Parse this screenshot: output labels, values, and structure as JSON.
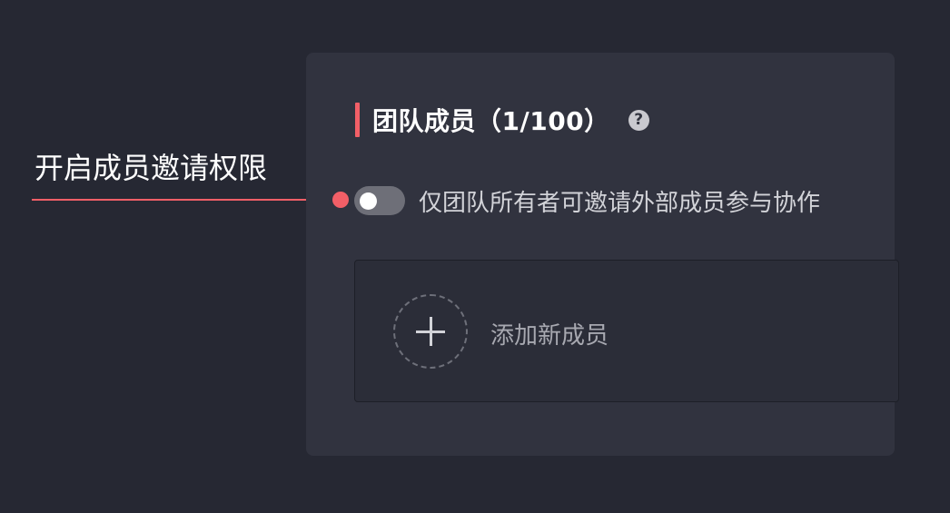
{
  "annotation": {
    "label": "开启成员邀请权限"
  },
  "panel": {
    "title": "团队成员（1/100）",
    "help_icon_glyph": "?",
    "toggle": {
      "state": "off",
      "label": "仅团队所有者可邀请外部成员参与协作"
    },
    "add_member": {
      "label": "添加新成员"
    }
  },
  "colors": {
    "accent": "#f25f67",
    "background": "#262833",
    "panel": "#31333f",
    "toggle_off": "#6e6f78"
  }
}
